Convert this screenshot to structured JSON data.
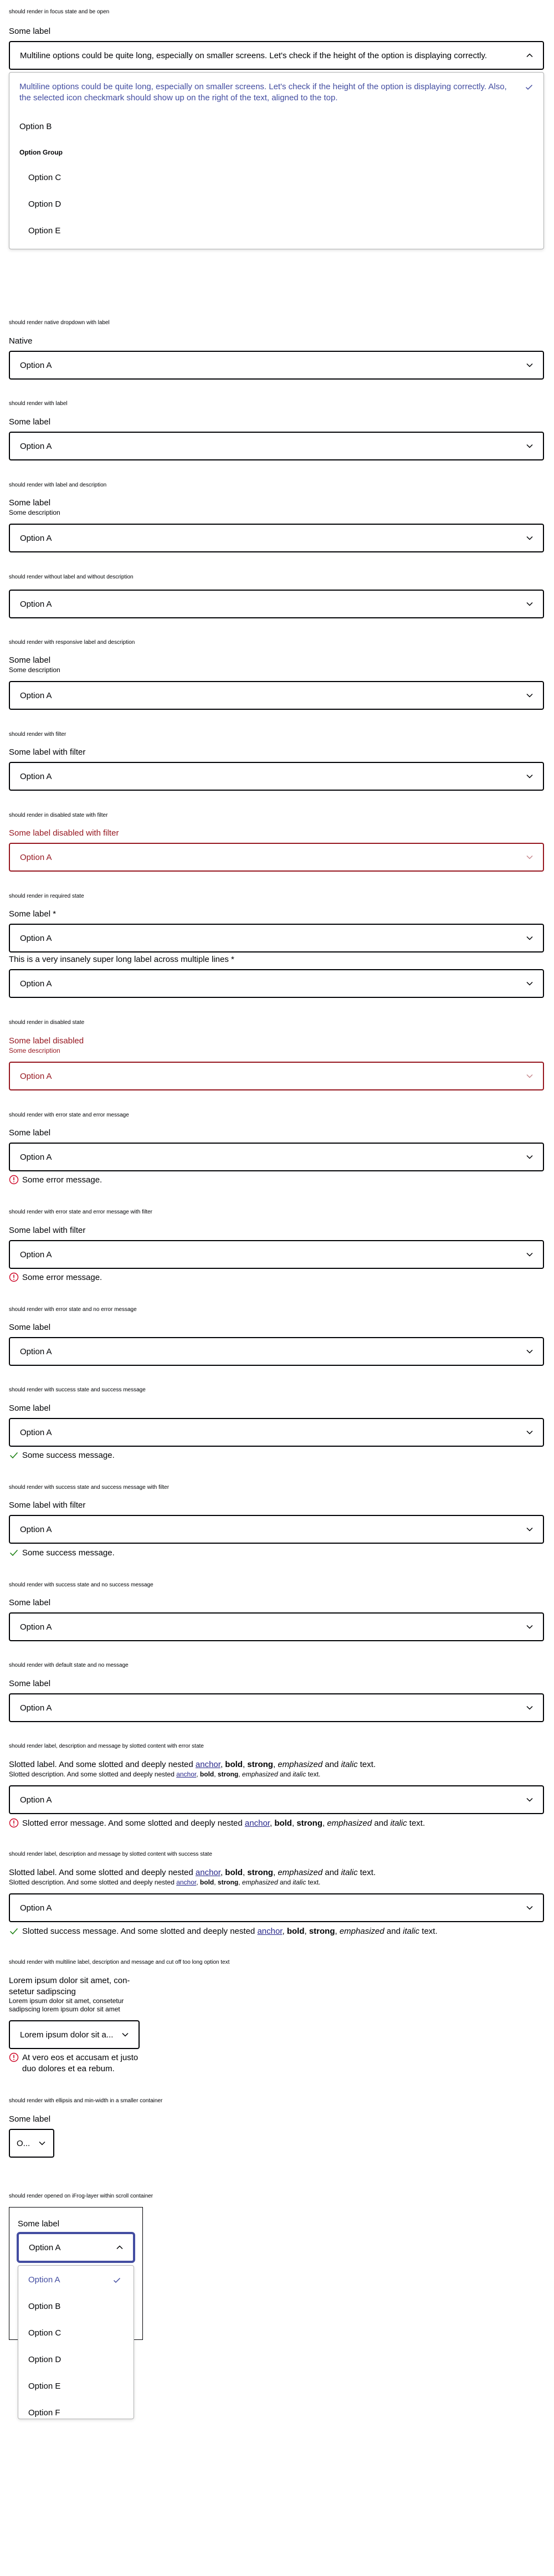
{
  "colors": {
    "text": "#010205",
    "selected": "#434da1",
    "disabled": "#96161f",
    "error": "#cc0022",
    "success": "#197e10"
  },
  "s1": {
    "caption": "should render in focus state and be open",
    "label": "Some label",
    "value": "Multiline options could be quite long, especially on smaller screens. Let's check if the height of the option is displaying correctly.",
    "options": {
      "multiline": "Multiline options could be quite long, especially on smaller screens. Let's check if the height of the option is displaying correctly. Also, the selected icon checkmark should show up on the right of the text, aligned to the top.",
      "b": "Option B",
      "group": "Option Group",
      "c": "Option C",
      "d": "Option D",
      "e": "Option E"
    }
  },
  "s2": {
    "caption": "should render native dropdown with label",
    "label": "Native",
    "value": "Option A"
  },
  "s3": {
    "caption": "should render with label",
    "label": "Some label",
    "value": "Option A"
  },
  "s4": {
    "caption": "should render with label and description",
    "label": "Some label",
    "description": "Some description",
    "value": "Option A"
  },
  "s5": {
    "caption": "should render without label and without description",
    "value": "Option A"
  },
  "s6": {
    "caption": "should render with responsive label and description",
    "label": "Some label",
    "description": "Some description",
    "value": "Option A"
  },
  "s7": {
    "caption": "should render with filter",
    "label": "Some label with filter",
    "value": "Option A"
  },
  "s8": {
    "caption": "should render in disabled state with filter",
    "label": "Some label disabled with filter",
    "value": "Option A"
  },
  "s9": {
    "caption": "should render in required state",
    "label": "Some label *",
    "value": "Option A",
    "label2": "This is a very insanely super long label across multiple lines *",
    "value2": "Option A"
  },
  "s10": {
    "caption": "should render in disabled state",
    "label": "Some label disabled",
    "description": "Some description",
    "value": "Option A"
  },
  "s11": {
    "caption": "should render with error state and error message",
    "label": "Some label",
    "value": "Option A",
    "message": "Some error message."
  },
  "s12": {
    "caption": "should render with error state and error message with filter",
    "label": "Some label with filter",
    "value": "Option A",
    "message": "Some error message."
  },
  "s13": {
    "caption": "should render with error state and no error message",
    "label": "Some label",
    "value": "Option A"
  },
  "s14": {
    "caption": "should render with success state and success message",
    "label": "Some label",
    "value": "Option A",
    "message": "Some success message."
  },
  "s15": {
    "caption": "should render with success state and success message with filter",
    "label": "Some label with filter",
    "value": "Option A",
    "message": "Some success message."
  },
  "s16": {
    "caption": "should render with success state and no success message",
    "label": "Some label",
    "value": "Option A"
  },
  "s17": {
    "caption": "should render with default state and no message",
    "label": "Some label",
    "value": "Option A"
  },
  "s18": {
    "caption": "should render label, description and message by slotted content with error state",
    "label_pre": "Slotted label. And some slotted and deeply nested ",
    "desc_pre": "Slotted description. And some slotted and deeply nested ",
    "msg_pre": "Slotted error message. And some slotted and deeply nested ",
    "anchor": "anchor",
    "sep1": ", ",
    "bold": "bold",
    "sep2": ", ",
    "strong": "strong",
    "sep3": ", ",
    "emphasized": "emphasized",
    "and": " and ",
    "italic": "italic",
    "text_end": " text.",
    "value": "Option A"
  },
  "s19": {
    "caption": "should render label, description and message by slotted content with success state",
    "label_pre": "Slotted label. And some slotted and deeply nested ",
    "desc_pre": "Slotted description. And some slotted and deeply nested ",
    "msg_pre": "Slotted success message. And some slotted and deeply nested ",
    "anchor": "anchor",
    "sep1": ", ",
    "bold": "bold",
    "sep2": ", ",
    "strong": "strong",
    "sep3": ", ",
    "emphasized": "emphasized",
    "and": " and ",
    "italic": "italic",
    "text_end": " text.",
    "value": "Option A"
  },
  "s20": {
    "caption": "should render with multiline label, description and message and cut off too long option text",
    "label_l1": "Lorem ipsum dolor sit amet, con-",
    "label_l2": "setetur sadipscing",
    "desc_l1": "Lorem ipsum dolor sit amet, consetetur",
    "desc_l2": "sadipscing lorem ipsum dolor sit amet",
    "value": "Lorem ipsum dolor sit a...",
    "msg_l1": "At vero eos et accusam et justo",
    "msg_l2": "duo dolores et ea rebum."
  },
  "s21": {
    "caption": "should render with ellipsis and min-width in a smaller container",
    "label": "Some label",
    "value": "O..."
  },
  "s22": {
    "caption": "should render opened on iFrog-layer within scroll container",
    "label": "Some label",
    "value": "Option A",
    "options": [
      "Option A",
      "Option B",
      "Option C",
      "Option D",
      "Option E",
      "Option F"
    ]
  }
}
